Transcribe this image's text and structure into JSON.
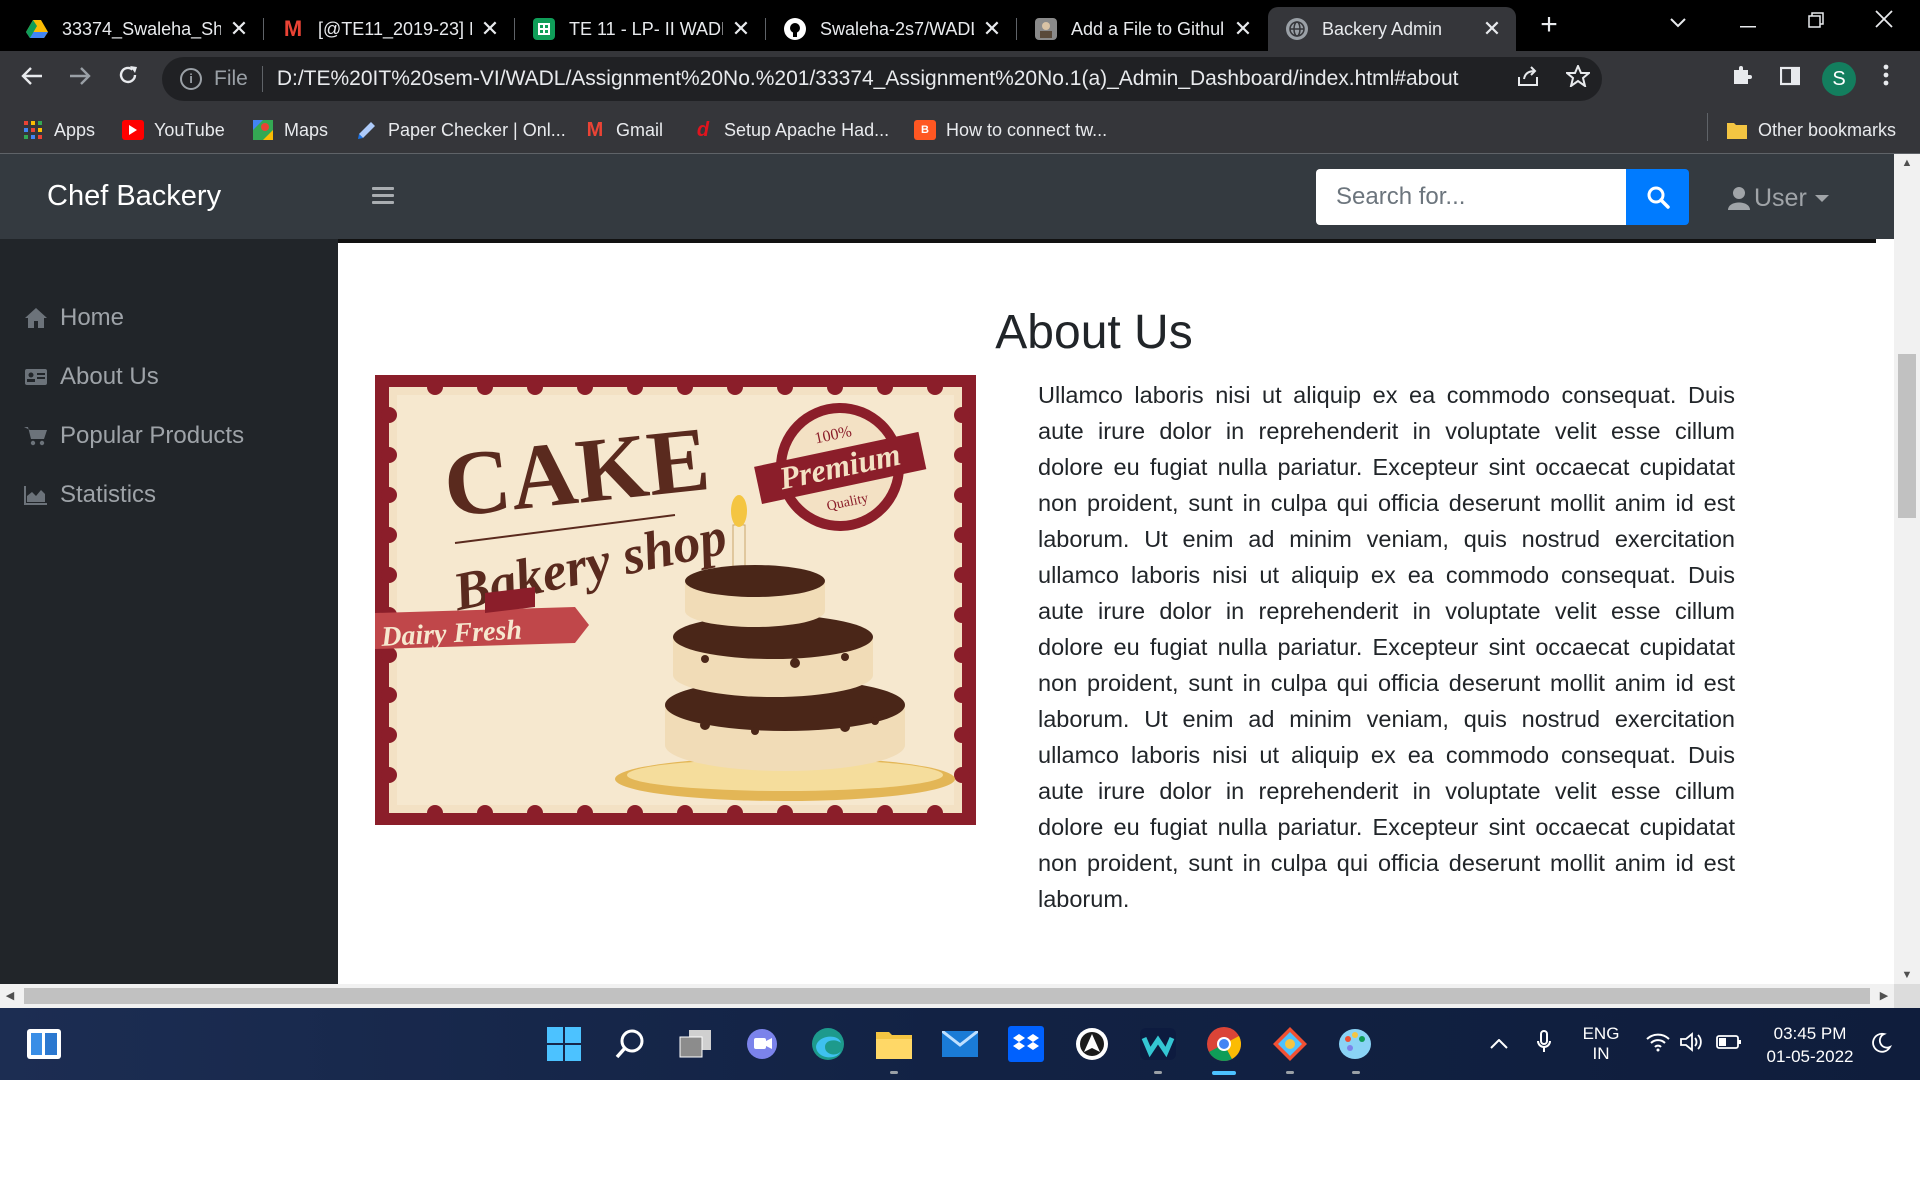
{
  "browser": {
    "tabs": [
      {
        "title": "33374_Swaleha_Sh",
        "favicon": "google-drive-icon",
        "color": "#1fa463",
        "active": false
      },
      {
        "title": "[@TE11_2019-23] F",
        "favicon": "gmail-icon",
        "color": "#ea4335",
        "active": false
      },
      {
        "title": "TE 11 - LP- II WADL",
        "favicon": "google-sheets-icon",
        "color": "#0f9d58",
        "active": false
      },
      {
        "title": "Swaleha-2s7/WADL",
        "favicon": "github-icon",
        "color": "#ffffff",
        "active": false
      },
      {
        "title": "Add a File to Githul",
        "favicon": "profile-photo-icon",
        "color": "#8a8a8a",
        "active": false
      },
      {
        "title": "Backery Admin",
        "favicon": "globe-icon",
        "color": "#9aa0a6",
        "active": true
      }
    ],
    "address": {
      "scheme": "File",
      "url": "D:/TE%20IT%20sem-VI/WADL/Assignment%20No.%201/33374_Assignment%20No.1(a)_Admin_Dashboard/index.html#about"
    },
    "profile_initial": "S",
    "bookmarks": [
      {
        "label": "Apps",
        "icon": "apps-grid-icon"
      },
      {
        "label": "YouTube",
        "icon": "youtube-icon"
      },
      {
        "label": "Maps",
        "icon": "maps-icon"
      },
      {
        "label": "Paper Checker | Onl...",
        "icon": "paper-checker-icon"
      },
      {
        "label": "Gmail",
        "icon": "gmail-icon"
      },
      {
        "label": "Setup Apache Had...",
        "icon": "bookmark-d-icon"
      },
      {
        "label": "How to connect tw...",
        "icon": "blogger-icon"
      }
    ],
    "other_bookmarks": "Other bookmarks"
  },
  "page": {
    "brand": "Chef Backery",
    "search": {
      "placeholder": "Search for..."
    },
    "user_label": "User",
    "sidebar": [
      {
        "label": "Home",
        "icon": "home-icon"
      },
      {
        "label": "About Us",
        "icon": "id-card-icon"
      },
      {
        "label": "Popular Products",
        "icon": "cart-icon"
      },
      {
        "label": "Statistics",
        "icon": "area-chart-icon"
      }
    ],
    "about": {
      "title": "About Us",
      "image_text": {
        "cake": "CAKE",
        "bakery": "Bakery shop",
        "premium": "Premium",
        "pct": "100%",
        "quality": "Quality",
        "dairy": "Dairy Fresh"
      },
      "paragraph": "Ullamco laboris nisi ut aliquip ex ea commodo consequat. Duis aute irure dolor in reprehenderit in voluptate velit esse cillum dolore eu fugiat nulla pariatur. Excepteur sint occaecat cupidatat non proident, sunt in culpa qui officia deserunt mollit anim id est laborum. Ut enim ad minim veniam, quis nostrud exercitation ullamco laboris nisi ut aliquip ex ea commodo consequat. Duis aute irure dolor in reprehenderit in voluptate velit esse cillum dolore eu fugiat nulla pariatur. Excepteur sint occaecat cupidatat non proident, sunt in culpa qui officia deserunt mollit anim id est laborum. Ut enim ad minim veniam, quis nostrud exercitation ullamco laboris nisi ut aliquip ex ea commodo consequat. Duis aute irure dolor in reprehenderit in voluptate velit esse cillum dolore eu fugiat nulla pariatur. Excepteur sint occaecat cupidatat non proident, sunt in culpa qui officia deserunt mollit anim id est laborum."
    }
  },
  "taskbar": {
    "language": "ENG",
    "region": "IN",
    "time": "03:45 PM",
    "date": "01-05-2022"
  },
  "colors": {
    "navbar": "#343a40",
    "sidebar": "#212529",
    "accent": "#007bff"
  }
}
